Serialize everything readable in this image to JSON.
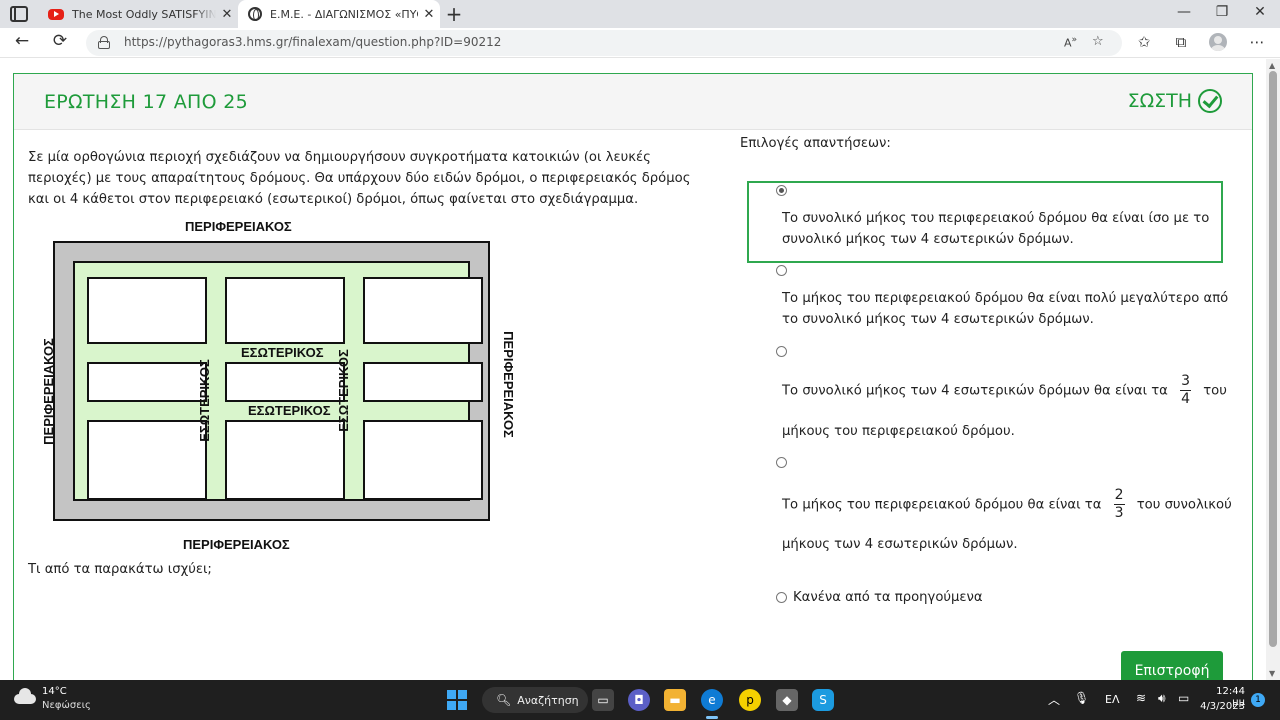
{
  "browser": {
    "tabs": [
      {
        "title": "The Most Oddly SATISFYING Video",
        "icon": "youtube-icon",
        "active": false
      },
      {
        "title": "Ε.Μ.Ε. - ΔΙΑΓΩΝΙΣΜΟΣ «ΠΥΘΑΓΟΡΑΣ»",
        "icon": "globe-icon",
        "active": true
      }
    ],
    "new_tab": "+",
    "url": "https://pythagoras3.hms.gr/finalexam/question.php?ID=90212",
    "window_controls": {
      "minimize": "—",
      "maximize": "❐",
      "close": "✕"
    }
  },
  "question": {
    "title": "ΕΡΩΤΗΣΗ 17 ΑΠΟ 25",
    "status": "ΣΩΣΤΗ",
    "text": "Σε μία ορθογώνια περιοχή σχεδιάζουν να δημιουργήσουν συγκροτήματα κατοικιών (οι λευκές περιοχές) με τους απαραίτητους δρόμους. Θα υπάρχουν δύο ειδών δρόμοι, ο περιφερειακός δρόμος και οι 4 κάθετοι στον περιφερειακό (εσωτερικοί) δρόμοι, όπως φαίνεται στο σχεδιάγραμμα.",
    "prompt": "Τι από τα παρακάτω ισχύει;",
    "diagram": {
      "outer_label": "ΠΕΡΙΦΕΡΕΙΑΚΟΣ",
      "inner_label": "ΕΣΩΤΕΡΙΚΟΣ",
      "colors": {
        "outer_road": "#c4c4c4",
        "inner_road": "#d9f5cc",
        "blocks": "#ffffff"
      }
    }
  },
  "answers": {
    "heading": "Επιλογές απαντήσεων:",
    "options": [
      {
        "line1": "Το συνολικό μήκος του περιφερειακού δρόμου θα είναι ίσο με το",
        "line2": "συνολικό μήκος των 4 εσωτερικών δρόμων.",
        "selected": true
      },
      {
        "line1": "Το μήκος του περιφερειακού δρόμου θα είναι πολύ μεγαλύτερο από",
        "line2": "το συνολικό μήκος των 4 εσωτερικών δρόμων.",
        "selected": false
      },
      {
        "pre": "Το συνολικό μήκος των 4 εσωτερικών δρόμων θα είναι τα",
        "num": "3",
        "den": "4",
        "post": "του",
        "line2": "μήκους του περιφερειακού δρόμου.",
        "selected": false
      },
      {
        "pre": "Το μήκος του περιφερειακού δρόμου θα είναι τα",
        "num": "2",
        "den": "3",
        "post": "του συνολικού",
        "line2": "μήκους των 4 εσωτερικών δρόμων.",
        "selected": false
      },
      {
        "line1": "Κανένα από τα προηγούμενα",
        "selected": false
      }
    ]
  },
  "back_button": "Επιστροφή",
  "taskbar": {
    "weather_temp": "14°C",
    "weather_desc": "Νεφώσεις",
    "search_label": "Αναζήτηση",
    "language": "ΕΛ",
    "time": "12:44 μμ",
    "date": "4/3/2023",
    "notifications": "1"
  },
  "colors": {
    "accent_green": "#1e9b3a",
    "selected_border": "#2fa84f"
  }
}
